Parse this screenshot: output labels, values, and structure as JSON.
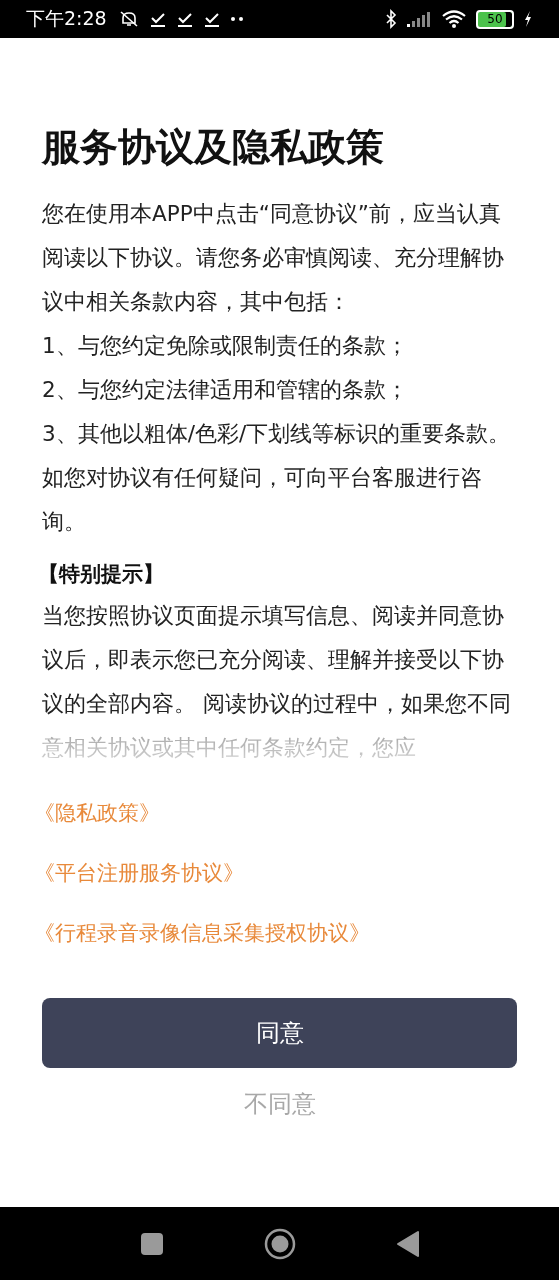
{
  "status_bar": {
    "time": "下午2:28",
    "battery": "50"
  },
  "title": "服务协议及隐私政策",
  "intro": [
    "您在使用本APP中点击“同意协议”前，应当认真阅读以下协议。请您务必审慎阅读、充分理解协议中相关条款内容，其中包括：",
    "1、与您约定免除或限制责任的条款；",
    "2、与您约定法律适用和管辖的条款；",
    "3、其他以粗体/色彩/下划线等标识的重要条款。",
    "如您对协议有任何疑问，可向平台客服进行咨询。"
  ],
  "notice_heading": "【特别提示】",
  "notice_text": "当您按照协议页面提示填写信息、阅读并同意协议后，即表示您已充分阅读、理解并接受以下协议的全部内容。 阅读协议的过程中，如果您不同意相关协议或其中任何条款约定，您应",
  "links": [
    "《隐私政策》",
    "《平台注册服务协议》",
    "《行程录音录像信息采集授权协议》"
  ],
  "agree_button": "同意",
  "disagree_button": "不同意"
}
